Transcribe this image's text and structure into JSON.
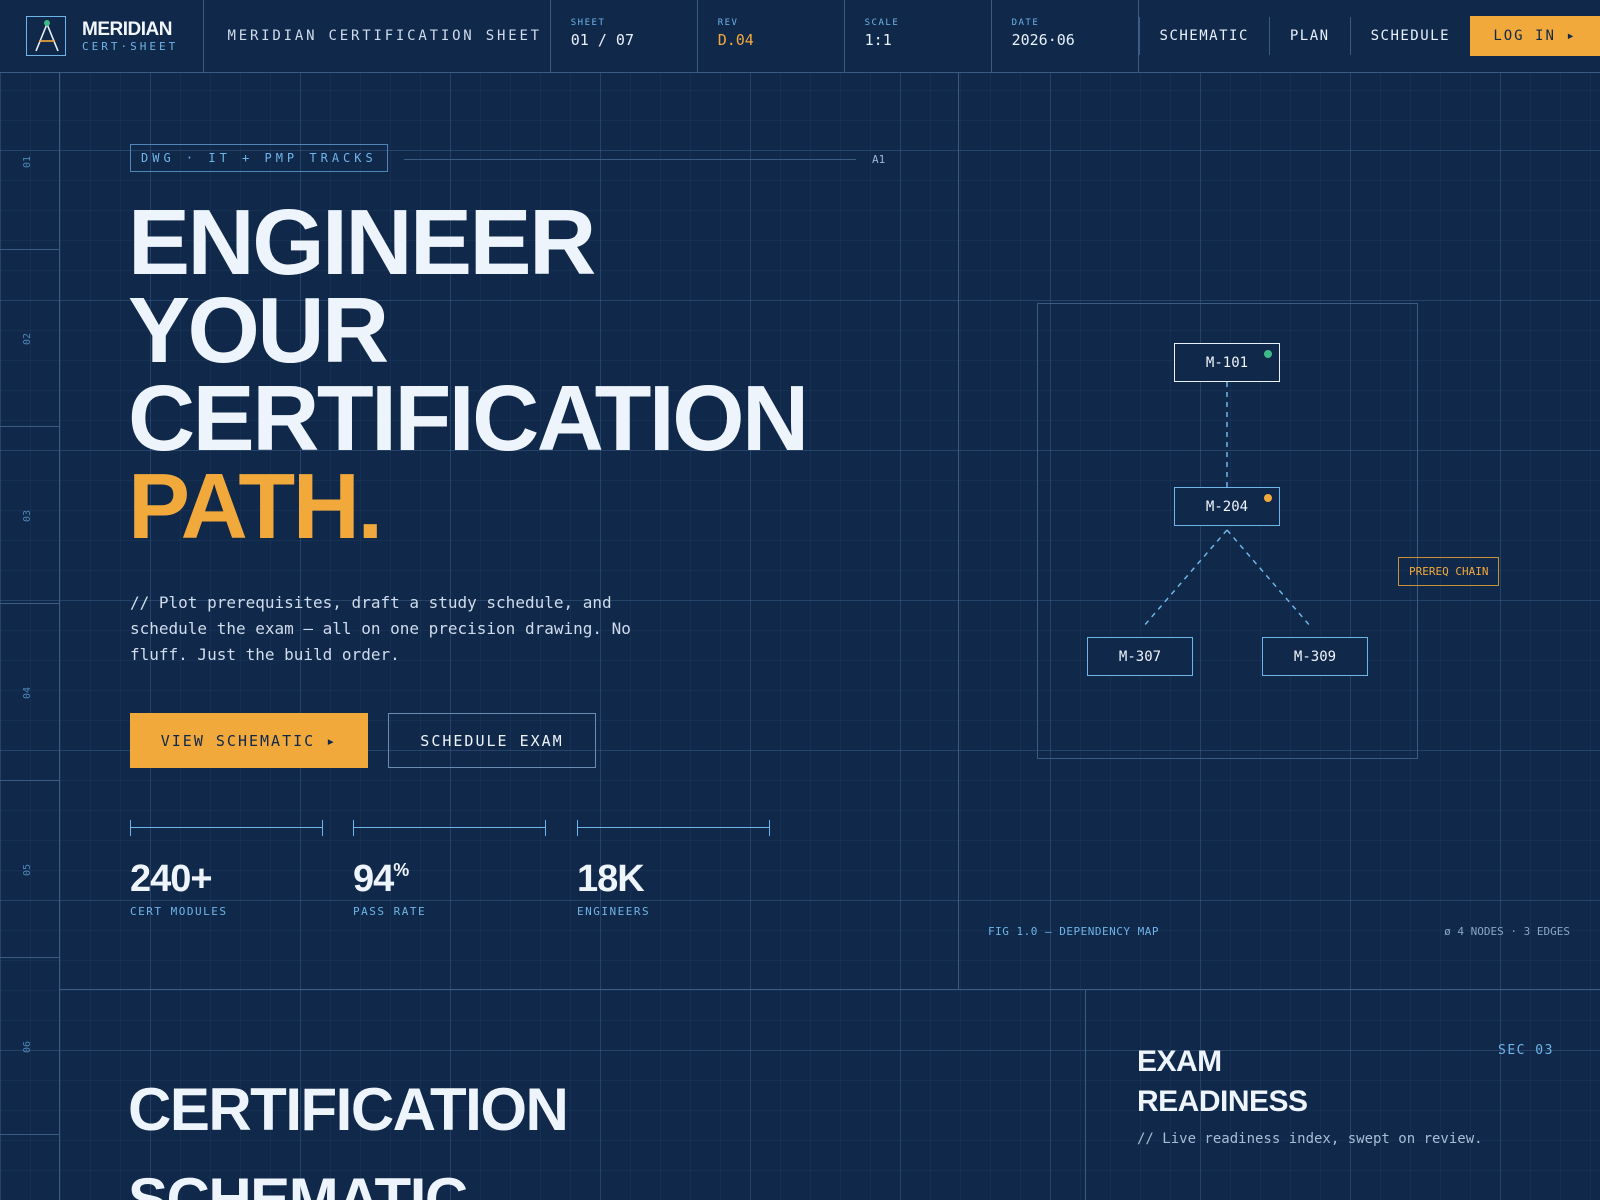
{
  "brand": {
    "name": "MERIDIAN",
    "sub": "CERT·SHEET",
    "logo_icon": "compass-icon"
  },
  "header": {
    "doc_title": "MERIDIAN CERTIFICATION SHEET",
    "meta": [
      {
        "label": "SHEET",
        "value": "01 / 07"
      },
      {
        "label": "REV",
        "value": "D.04"
      },
      {
        "label": "SCALE",
        "value": "1:1"
      },
      {
        "label": "DATE",
        "value": "2026·06"
      }
    ],
    "nav": [
      "SCHEMATIC",
      "PLAN",
      "SCHEDULE"
    ],
    "login_label": "LOG IN ▸"
  },
  "ruler": [
    "01",
    "02",
    "03",
    "04",
    "05",
    "06"
  ],
  "hero": {
    "tag": "DWG · IT + PMP TRACKS",
    "tag_code": "A1",
    "headline": [
      "ENGINEER",
      "YOUR",
      "CERTIFICATION"
    ],
    "headline_accent": "PATH.",
    "lede": "// Plot prerequisites, draft a study schedule, and schedule the exam — all on one precision drawing. No fluff. Just the build order.",
    "primary_cta": "VIEW SCHEMATIC ▸",
    "secondary_cta": "SCHEDULE EXAM",
    "stats": [
      {
        "value": "240+",
        "sup": "",
        "label": "CERT MODULES"
      },
      {
        "value": "94",
        "sup": "%",
        "label": "PASS RATE"
      },
      {
        "value": "18K",
        "sup": "",
        "label": "ENGINEERS"
      }
    ]
  },
  "diagram": {
    "nodes": [
      {
        "id": "M-101",
        "status_color": "#3fb98a"
      },
      {
        "id": "M-204",
        "status_color": "#f2a93b"
      },
      {
        "id": "M-307",
        "status_color": ""
      },
      {
        "id": "M-309",
        "status_color": ""
      }
    ],
    "callout": "PREREQ CHAIN",
    "caption": "FIG 1.0 — DEPENDENCY MAP",
    "meta": "ø 4 NODES · 3 EDGES"
  },
  "lower": {
    "title": [
      "CERTIFICATION",
      "SCHEMATIC"
    ],
    "exam_title": [
      "EXAM",
      "READINESS"
    ],
    "sec_code": "SEC 03",
    "exam_sub": "// Live readiness index, swept on review."
  },
  "colors": {
    "background": "#10284a",
    "accent": "#f2a93b",
    "line": "#3b5c82",
    "blue": "#6fb5e8"
  }
}
